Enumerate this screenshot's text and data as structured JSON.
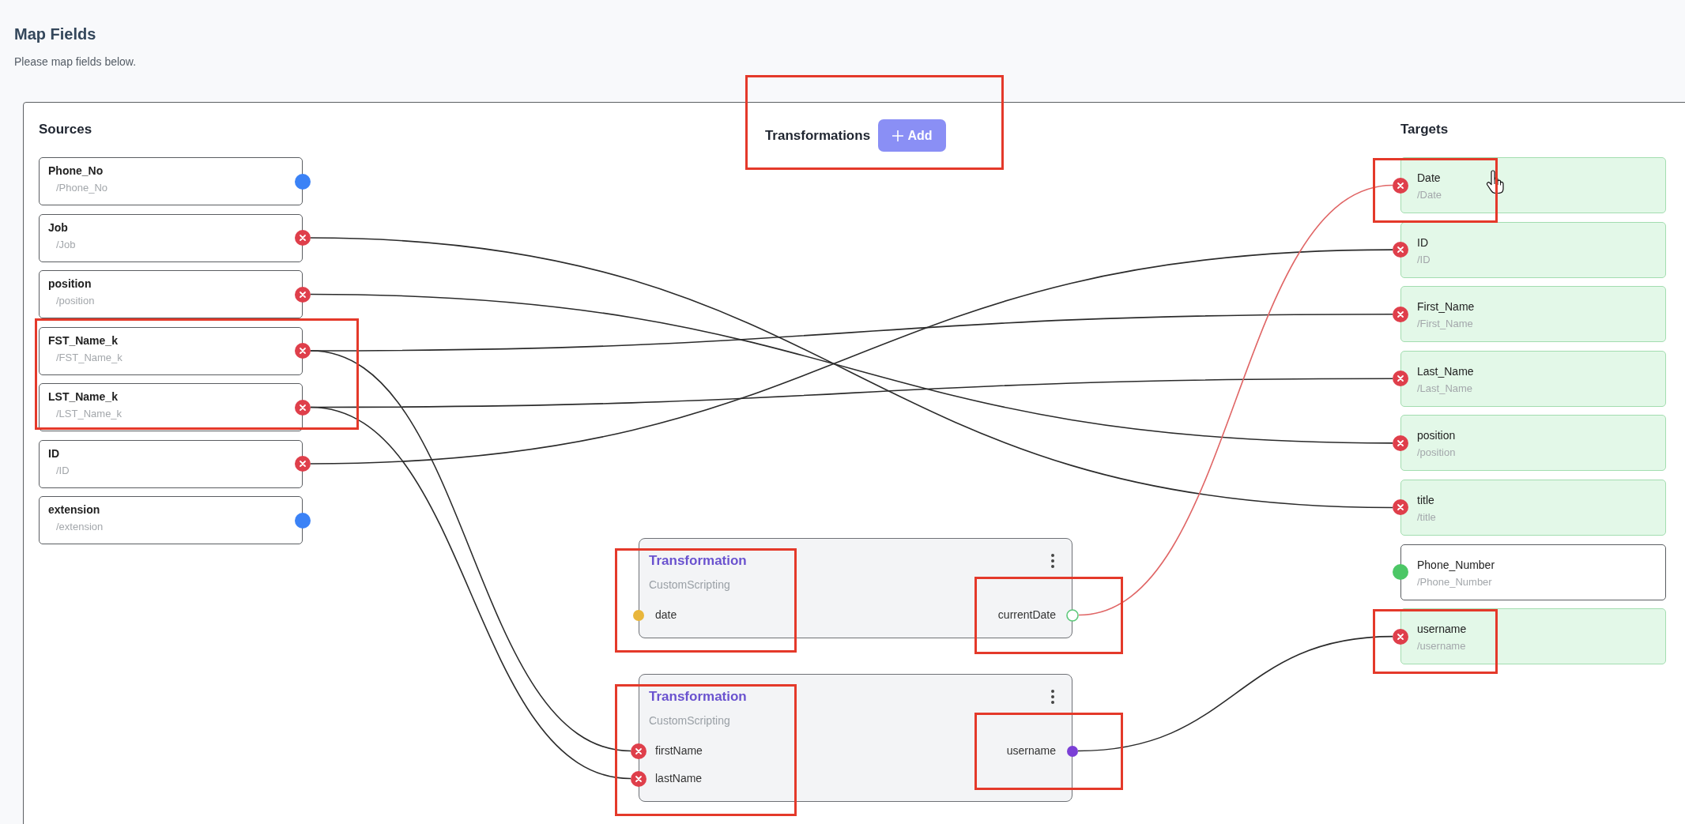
{
  "page": {
    "title": "Map Fields",
    "description": "Please map fields below."
  },
  "sources": {
    "heading": "Sources",
    "items": [
      {
        "name": "Phone_No",
        "path": "/Phone_No",
        "connected": false,
        "highlighted": false
      },
      {
        "name": "Job",
        "path": "/Job",
        "connected": true,
        "highlighted": false
      },
      {
        "name": "position",
        "path": "/position",
        "connected": true,
        "highlighted": false
      },
      {
        "name": "FST_Name_k",
        "path": "/FST_Name_k",
        "connected": true,
        "highlighted": true
      },
      {
        "name": "LST_Name_k",
        "path": "/LST_Name_k",
        "connected": true,
        "highlighted": true
      },
      {
        "name": "ID",
        "path": "/ID",
        "connected": true,
        "highlighted": false
      },
      {
        "name": "extension",
        "path": "/extension",
        "connected": false,
        "highlighted": false
      }
    ]
  },
  "transformations": {
    "heading": "Transformations",
    "add_button": "Add",
    "highlighted": true,
    "nodes": [
      {
        "title": "Transformation",
        "subtitle": "CustomScripting",
        "highlighted": true,
        "inputs": [
          {
            "label": "date",
            "kind": "dot",
            "color": "#e9b63b"
          }
        ],
        "output": {
          "label": "currentDate",
          "kind": "ring",
          "highlighted": true
        }
      },
      {
        "title": "Transformation",
        "subtitle": "CustomScripting",
        "highlighted": true,
        "inputs": [
          {
            "label": "firstName",
            "kind": "linked"
          },
          {
            "label": "lastName",
            "kind": "linked"
          }
        ],
        "output": {
          "label": "username",
          "kind": "dot",
          "color": "#7b3fd6",
          "highlighted": true
        }
      }
    ]
  },
  "targets": {
    "heading": "Targets",
    "items": [
      {
        "name": "Date",
        "path": "/Date",
        "connected": true,
        "highlighted": true,
        "hovered": true
      },
      {
        "name": "ID",
        "path": "/ID",
        "connected": true,
        "highlighted": false,
        "hovered": false
      },
      {
        "name": "First_Name",
        "path": "/First_Name",
        "connected": true,
        "highlighted": false,
        "hovered": false
      },
      {
        "name": "Last_Name",
        "path": "/Last_Name",
        "connected": true,
        "highlighted": false,
        "hovered": false
      },
      {
        "name": "position",
        "path": "/position",
        "connected": true,
        "highlighted": false,
        "hovered": false
      },
      {
        "name": "title",
        "path": "/title",
        "connected": true,
        "highlighted": false,
        "hovered": false
      },
      {
        "name": "Phone_Number",
        "path": "/Phone_Number",
        "connected": false,
        "highlighted": false,
        "hovered": false
      },
      {
        "name": "username",
        "path": "/username",
        "connected": true,
        "highlighted": true,
        "hovered": false
      }
    ]
  }
}
